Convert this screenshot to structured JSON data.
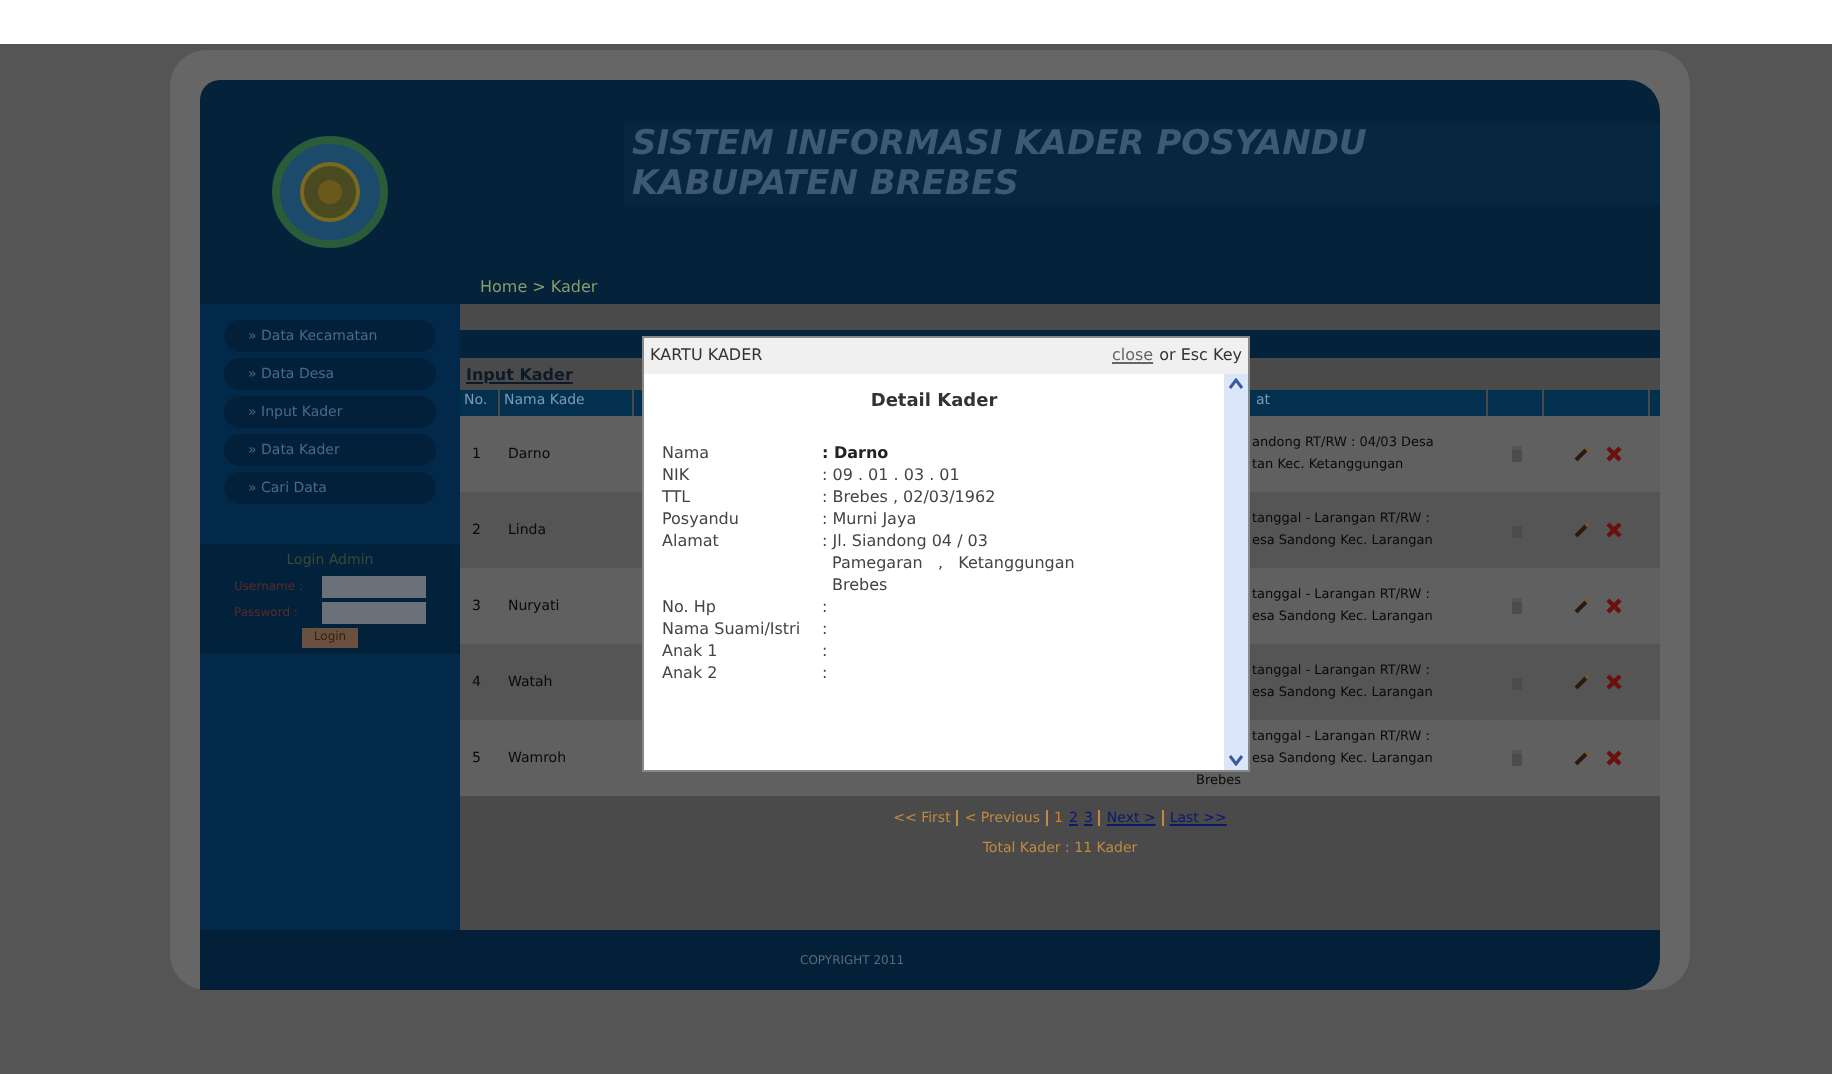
{
  "header": {
    "title_lines": [
      "SISTEM INFORMASI KADER POSYANDU",
      "KABUPATEN BREBES"
    ]
  },
  "breadcrumb": "Home > Kader",
  "sidebar": {
    "menu": [
      {
        "label": "» Data Kecamatan"
      },
      {
        "label": "» Data Desa"
      },
      {
        "label": "» Input Kader"
      },
      {
        "label": "» Data Kader"
      },
      {
        "label": "» Cari Data"
      }
    ],
    "login": {
      "title": "Login Admin",
      "fields": [
        {
          "label": "Username :"
        },
        {
          "label": "Password :"
        }
      ],
      "button": "Login"
    }
  },
  "content": {
    "link": "Input Kader",
    "table": {
      "columns": [
        "No.",
        "Nama Kade",
        "",
        "at",
        "",
        ""
      ],
      "rows": [
        {
          "no": "1",
          "name": "Darno",
          "address": [
            "andong RT/RW : 04/03 Desa",
            "tan Kec. Ketanggungan"
          ]
        },
        {
          "no": "2",
          "name": "Linda",
          "address": [
            "tanggal - Larangan RT/RW :",
            "esa Sandong Kec. Larangan"
          ]
        },
        {
          "no": "3",
          "name": "Nuryati",
          "address": [
            "tanggal - Larangan RT/RW :",
            "esa Sandong Kec. Larangan"
          ]
        },
        {
          "no": "4",
          "name": "Watah",
          "address": [
            "tanggal - Larangan RT/RW :",
            "esa Sandong Kec. Larangan"
          ]
        },
        {
          "no": "5",
          "name": "Wamroh",
          "address": [
            "tanggal - Larangan RT/RW :",
            "esa Sandong Kec. Larangan",
            "Brebes"
          ]
        }
      ]
    },
    "pagination": [
      {
        "text": "<< First",
        "kind": "inactive"
      },
      {
        "kind": "separator"
      },
      {
        "text": "< Previous",
        "kind": "inactive"
      },
      {
        "kind": "separator"
      },
      {
        "text": "1",
        "kind": "current"
      },
      {
        "text": "2",
        "kind": "link"
      },
      {
        "text": "3",
        "kind": "link"
      },
      {
        "kind": "separator"
      },
      {
        "text": "Next >",
        "kind": "link"
      },
      {
        "kind": "separator"
      },
      {
        "text": "Last >>",
        "kind": "link"
      }
    ],
    "total": "Total Kader : 11 Kader"
  },
  "footer": "COPYRIGHT 2011",
  "modal": {
    "title": "KARTU KADER",
    "close_link": "close",
    "close_hint": "or Esc Key",
    "heading": "Detail Kader",
    "fields": [
      {
        "label": "Nama",
        "lines": [
          ": Darno"
        ],
        "bold": true
      },
      {
        "label": "NIK",
        "lines": [
          ": 09 . 01 . 03 . 01"
        ],
        "bold": false
      },
      {
        "label": "TTL",
        "lines": [
          ": Brebes , 02/03/1962"
        ],
        "bold": false
      },
      {
        "label": "Posyandu",
        "lines": [
          ": Murni Jaya"
        ],
        "bold": false
      },
      {
        "label": "Alamat",
        "lines": [
          ": Jl. Siandong 04 / 03",
          "Pamegaran   ,   Ketanggungan",
          "Brebes"
        ],
        "bold": false
      },
      {
        "label": "No. Hp",
        "lines": [
          ":"
        ],
        "bold": false
      },
      {
        "label": "Nama Suami/Istri",
        "lines": [
          ":"
        ],
        "bold": false
      },
      {
        "label": "Anak 1",
        "lines": [
          ":"
        ],
        "bold": false
      },
      {
        "label": "Anak 2",
        "lines": [
          ":"
        ],
        "bold": false
      }
    ]
  }
}
